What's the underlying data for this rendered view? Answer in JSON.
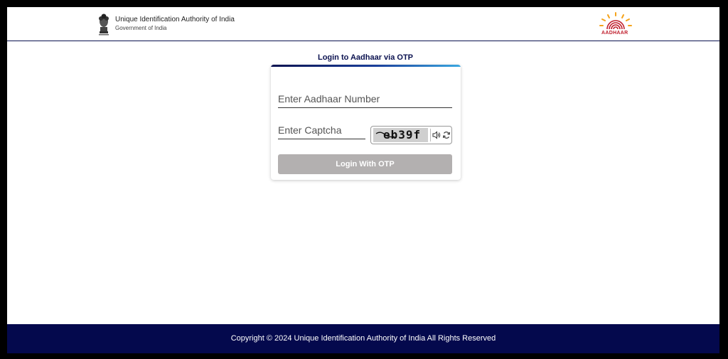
{
  "header": {
    "org_name": "Unique Identification Authority of India",
    "org_sub": "Government of India",
    "logo_text": "AADHAAR"
  },
  "login": {
    "title": "Login to Aadhaar via OTP",
    "aadhaar_placeholder": "Enter Aadhaar Number",
    "captcha_placeholder": "Enter Captcha",
    "captcha_text": "eb39f",
    "button_label": "Login With OTP"
  },
  "footer": {
    "text": "Copyright © 2024 Unique Identification Authority of India All Rights Reserved"
  },
  "colors": {
    "navy": "#0b1250",
    "footer_bg": "#04094d",
    "button_disabled": "#b3b0b0",
    "aadhaar_red": "#c0202e",
    "aadhaar_sun": "#f5a31a"
  },
  "icons": [
    "emblem-icon",
    "aadhaar-logo-icon",
    "speaker-icon",
    "refresh-icon"
  ]
}
